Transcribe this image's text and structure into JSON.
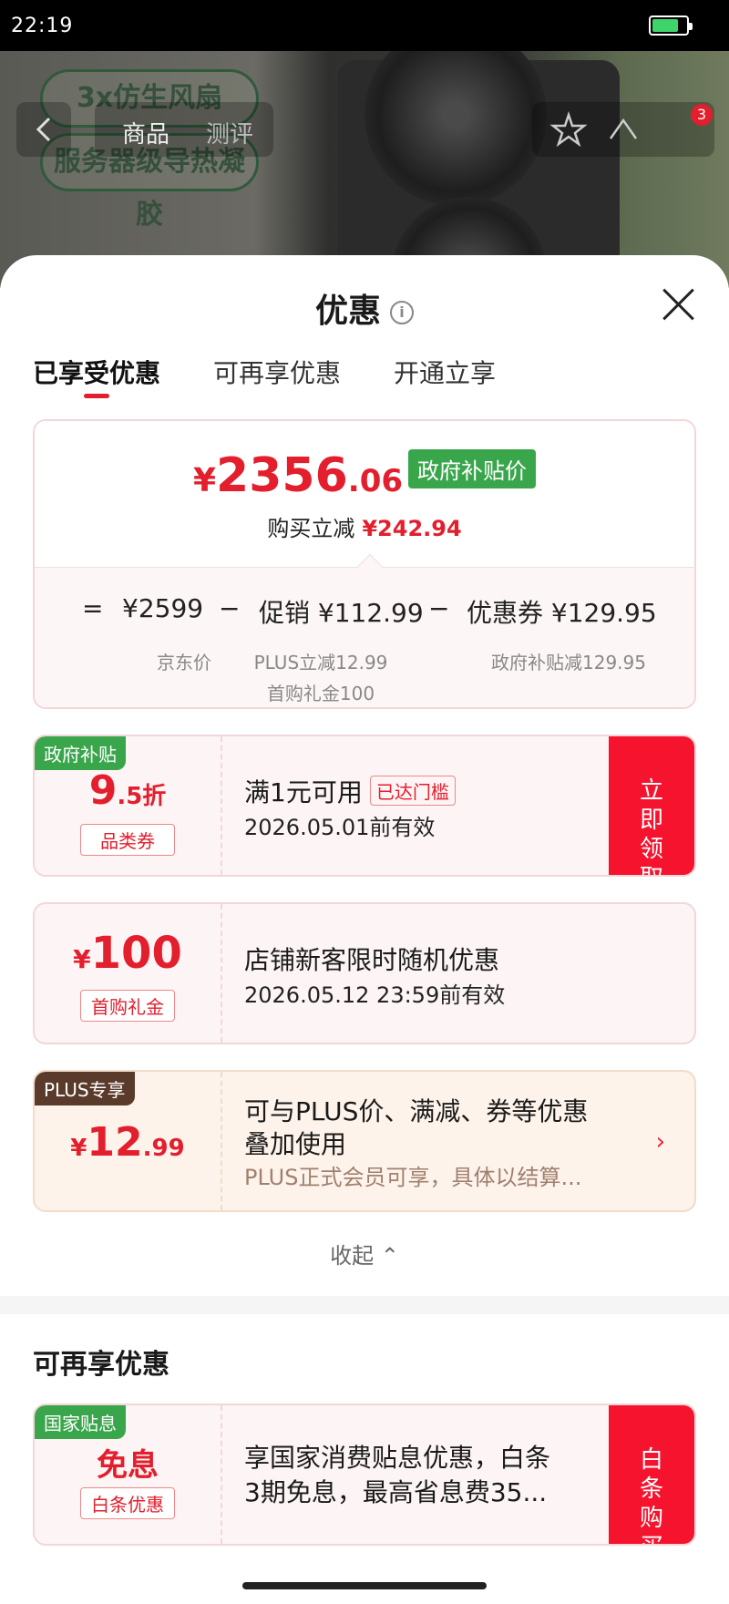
{
  "status_bar": {
    "time": "22:19"
  },
  "background": {
    "pill_lines": [
      "3x仿生风扇",
      "服务器级导热凝胶"
    ],
    "nav_tabs": [
      "商品",
      "测评"
    ],
    "badge_count": "3"
  },
  "sheet": {
    "title": "优惠",
    "tabs": [
      "已享受优惠",
      "可再享优惠",
      "开通立享"
    ],
    "summary": {
      "price_symbol": "¥",
      "price_integer": "2356",
      "price_decimal": ".06",
      "price_badge": "政府补贴价",
      "reduce_label": "购买立减",
      "reduce_amount": "¥242.94",
      "formula": {
        "equals": "=",
        "jd_price": "¥2599",
        "minus1": "−",
        "promo": "促销 ¥112.99",
        "minus2": "−",
        "coupon": "优惠券 ¥129.95",
        "jd_price_label": "京东价",
        "promo_detail_1": "PLUS立减12.99",
        "promo_detail_2": "首购礼金100",
        "coupon_detail": "政府补贴减129.95"
      }
    },
    "cards": [
      {
        "tag": "政府补贴",
        "big_value": "9",
        "big_suffix": ".5折",
        "sub_label": "品类券",
        "main_text": "满1元可用",
        "threshold": "已达门槛",
        "sub_text": "2026.05.01前有效",
        "action": "立即领取"
      },
      {
        "big_symbol": "¥",
        "big_value": "100",
        "sub_label": "首购礼金",
        "main_text": "店铺新客限时随机优惠",
        "sub_text": "2026.05.12 23:59前有效"
      },
      {
        "tag": "PLUS专享",
        "big_symbol": "¥",
        "big_value": "12",
        "big_suffix": ".99",
        "main_text_1": "可与PLUS价、满减、券等优惠",
        "main_text_2": "叠加使用",
        "sub_text": "PLUS正式会员可享，具体以结算..."
      }
    ],
    "collapse_label": "收起",
    "section2_title": "可再享优惠",
    "card4": {
      "tag": "国家贴息",
      "big_value": "免息",
      "sub_label": "白条优惠",
      "main_text_1": "享国家消费贴息优惠，白条",
      "main_text_2": "3期免息，最高省息费35...",
      "action": "白条购买"
    }
  },
  "colors": {
    "accent": "#e31e2d",
    "gov_green": "#3aa64c",
    "plus_brown": "#5a3a2a",
    "action_red": "#f5132e"
  }
}
